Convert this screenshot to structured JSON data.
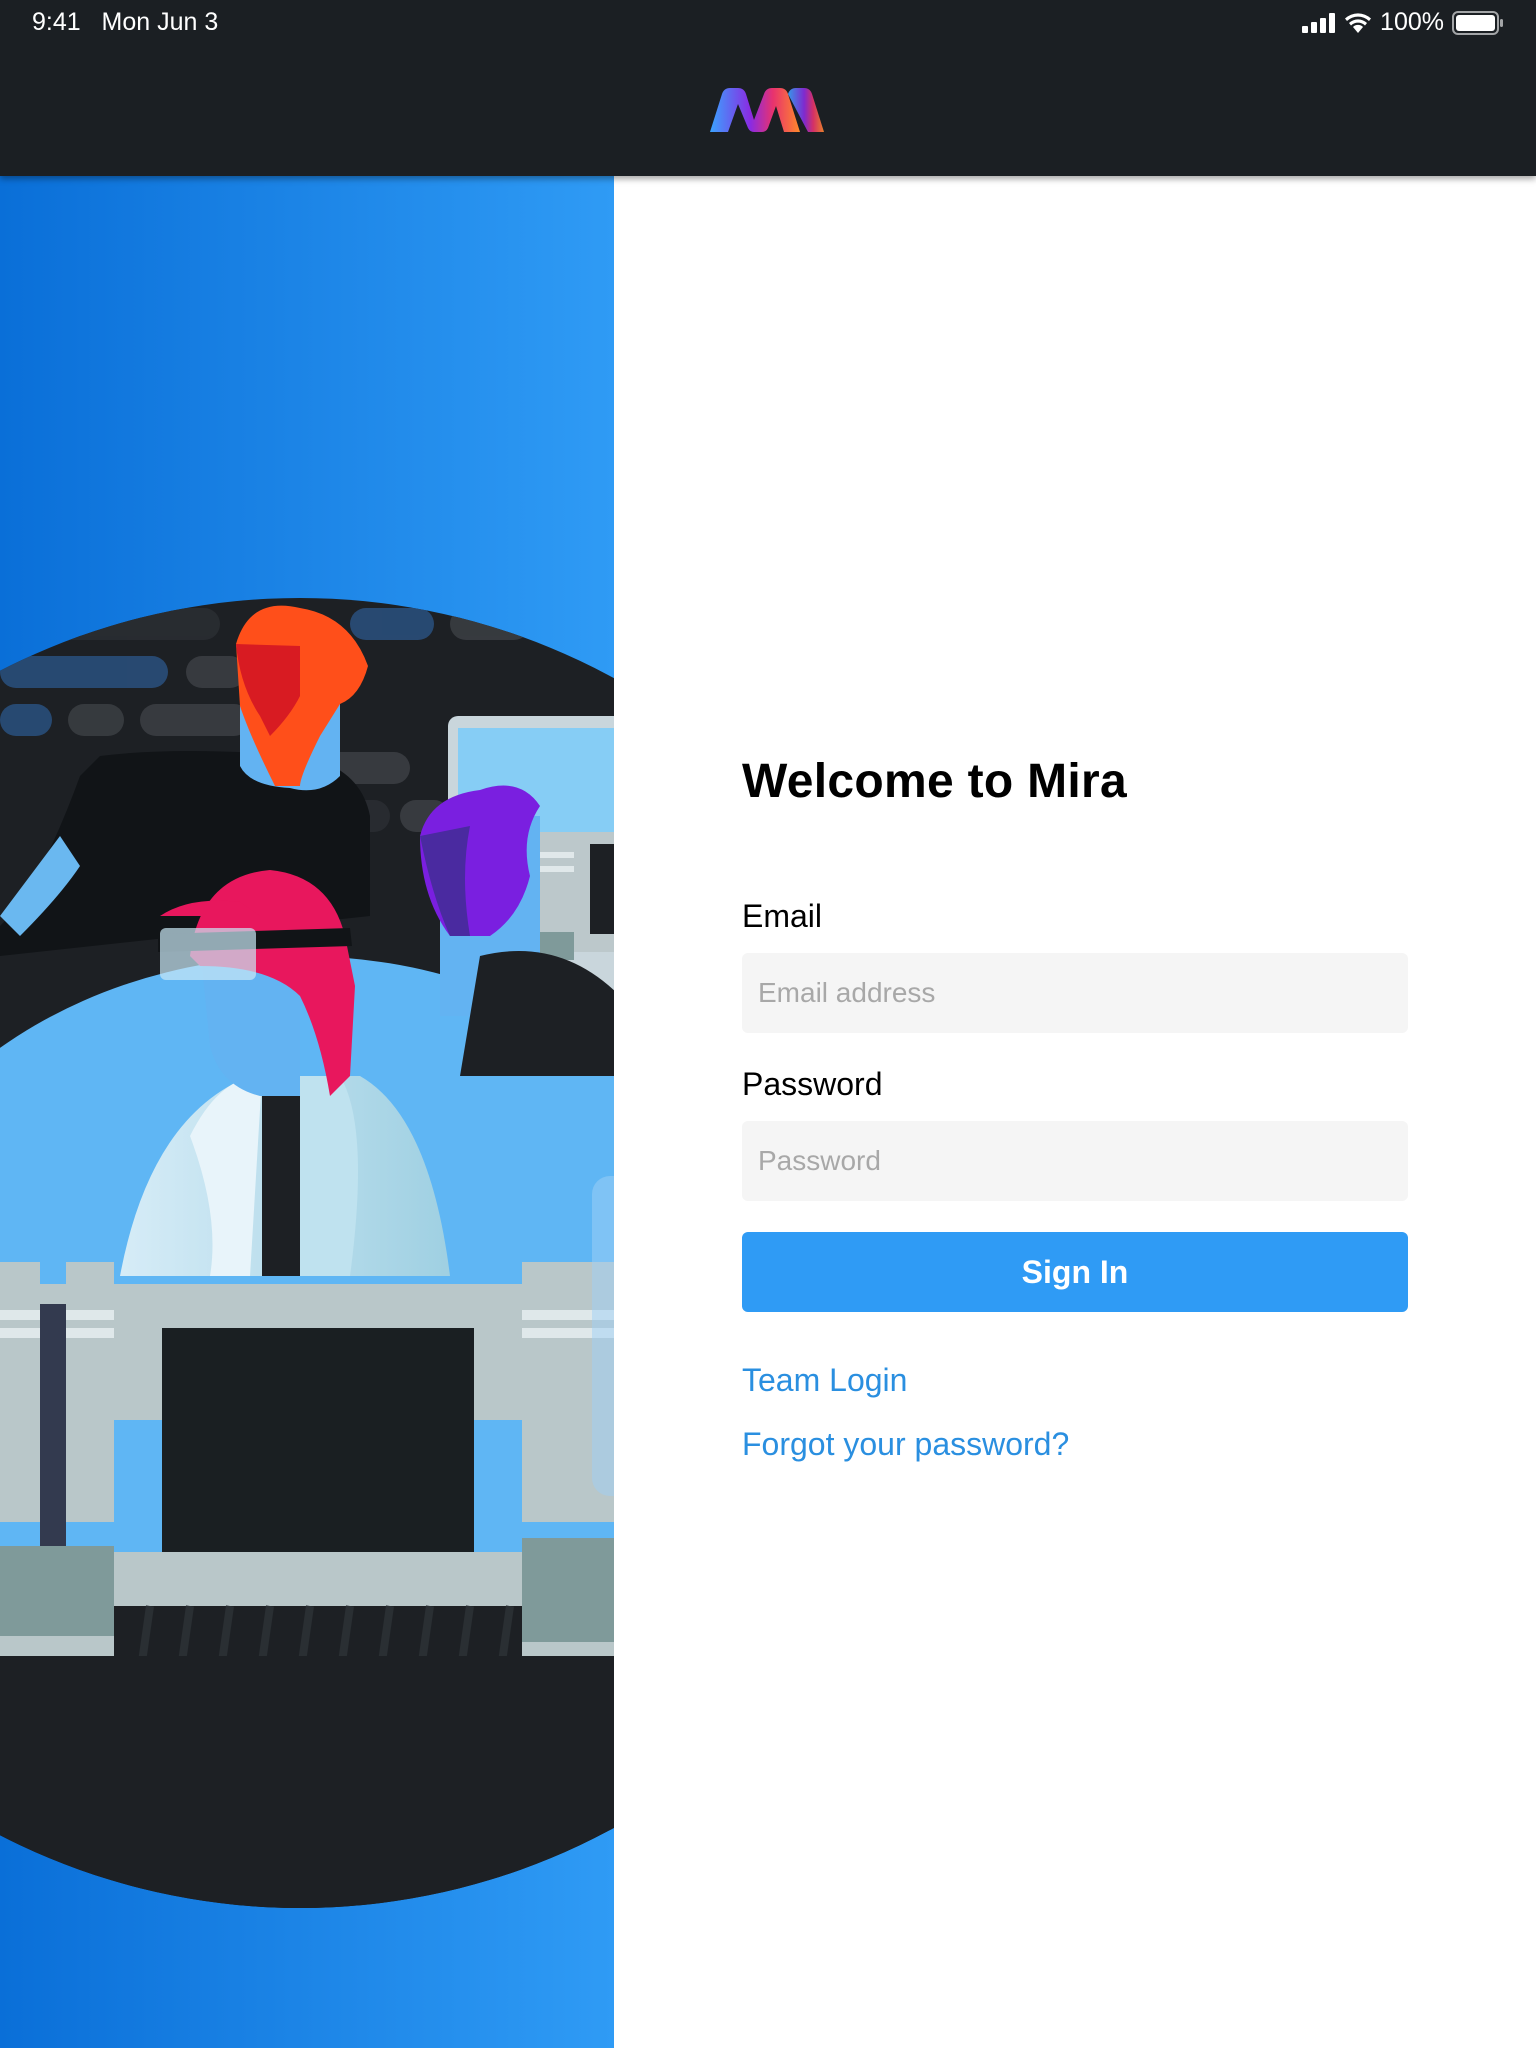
{
  "status_bar": {
    "time": "9:41",
    "date": "Mon Jun 3",
    "battery_percent": "100%",
    "signal_icon": "cellular-signal-icon",
    "wifi_icon": "wifi-icon",
    "battery_icon": "battery-icon"
  },
  "header": {
    "logo_icon": "mira-logo"
  },
  "form": {
    "title": "Welcome to Mira",
    "email_label": "Email",
    "email_placeholder": "Email address",
    "email_value": "",
    "password_label": "Password",
    "password_placeholder": "Password",
    "password_value": "",
    "sign_in_label": "Sign In",
    "team_login_label": "Team Login",
    "forgot_password_label": "Forgot your password?"
  },
  "colors": {
    "header_bg": "#1b1f23",
    "accent": "#2f9bf5",
    "link": "#2a8fe0",
    "input_bg": "#f5f5f5"
  }
}
